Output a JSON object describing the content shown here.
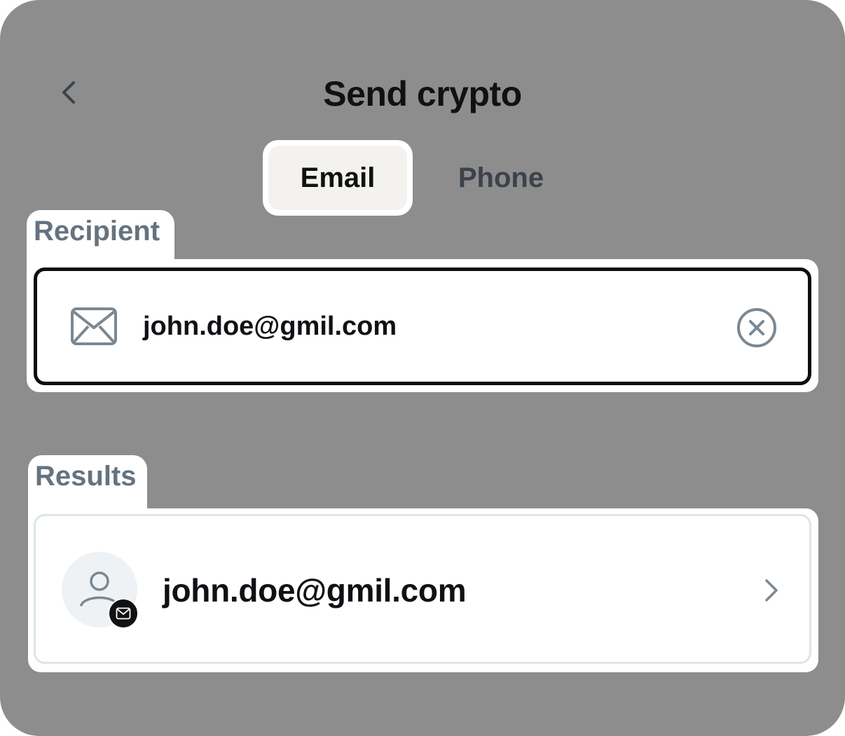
{
  "header": {
    "title": "Send crypto",
    "back_icon": "chevron-left-icon"
  },
  "tabs": [
    {
      "label": "Email",
      "active": true
    },
    {
      "label": "Phone",
      "active": false
    }
  ],
  "recipient": {
    "label": "Recipient",
    "input_value": "john.doe@gmil.com",
    "leading_icon": "mail-icon",
    "trailing_icon": "clear-icon"
  },
  "results": {
    "label": "Results",
    "items": [
      {
        "email": "john.doe@gmil.com",
        "avatar_icon": "user-icon",
        "badge_icon": "mail-icon",
        "trailing_icon": "chevron-right-icon"
      }
    ]
  },
  "colors": {
    "overlay_background": "#8d8d8d",
    "active_tab_fill": "#f3f2ef",
    "label_text": "#65737f",
    "input_border": "#0d0d0d",
    "icon_gray": "#7a8893"
  }
}
